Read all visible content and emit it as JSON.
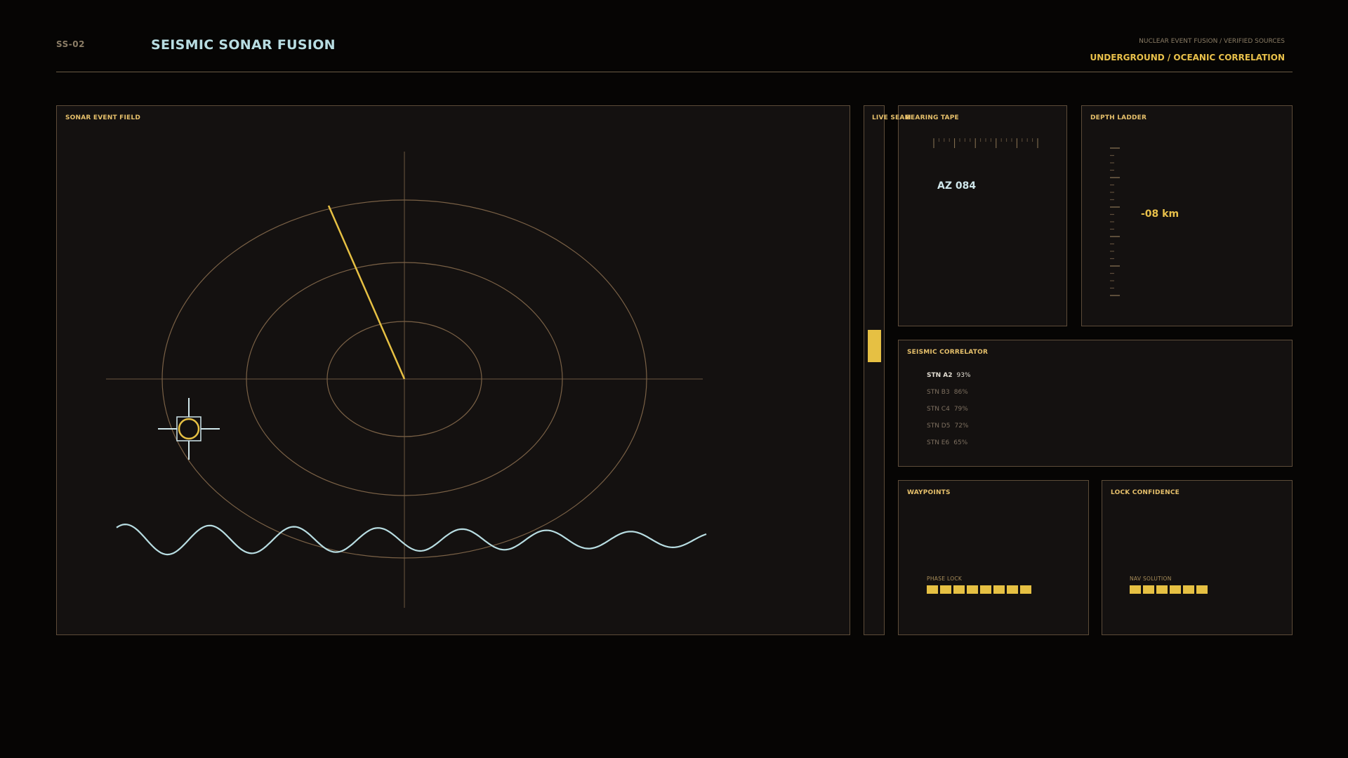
{
  "header": {
    "code": "SS-02",
    "title": "SEISMIC SONAR FUSION",
    "kicker": "NUCLEAR EVENT FUSION / VERIFIED SOURCES",
    "subtitle": "UNDERGROUND / OCEANIC CORRELATION"
  },
  "sonar_field": {
    "label": "SONAR EVENT FIELD"
  },
  "live_seam": {
    "label": "LIVE SEAM"
  },
  "bearing_tape": {
    "label": "BEARING TAPE",
    "azimuth": "AZ 084"
  },
  "depth_ladder": {
    "label": "DEPTH LADDER",
    "value": "-08 km"
  },
  "seismic_correlator": {
    "label": "SEISMIC CORRELATOR",
    "stations": [
      {
        "name": "STN A2",
        "pct": "93%"
      },
      {
        "name": "STN B3",
        "pct": "86%"
      },
      {
        "name": "STN C4",
        "pct": "79%"
      },
      {
        "name": "STN D5",
        "pct": "72%"
      },
      {
        "name": "STN E6",
        "pct": "65%"
      }
    ]
  },
  "waypoints": {
    "label": "WAYPOINTS",
    "meter_label": "PHASE LOCK",
    "segments": 8
  },
  "lock_confidence": {
    "label": "LOCK CONFIDENCE",
    "meter_label": "NAV SOLUTION",
    "segments": 6
  },
  "colors": {
    "accent_gold": "#e6c043",
    "accent_cyan": "#b8dde2",
    "frame_brown": "#5d4c39",
    "background": "#060504"
  }
}
